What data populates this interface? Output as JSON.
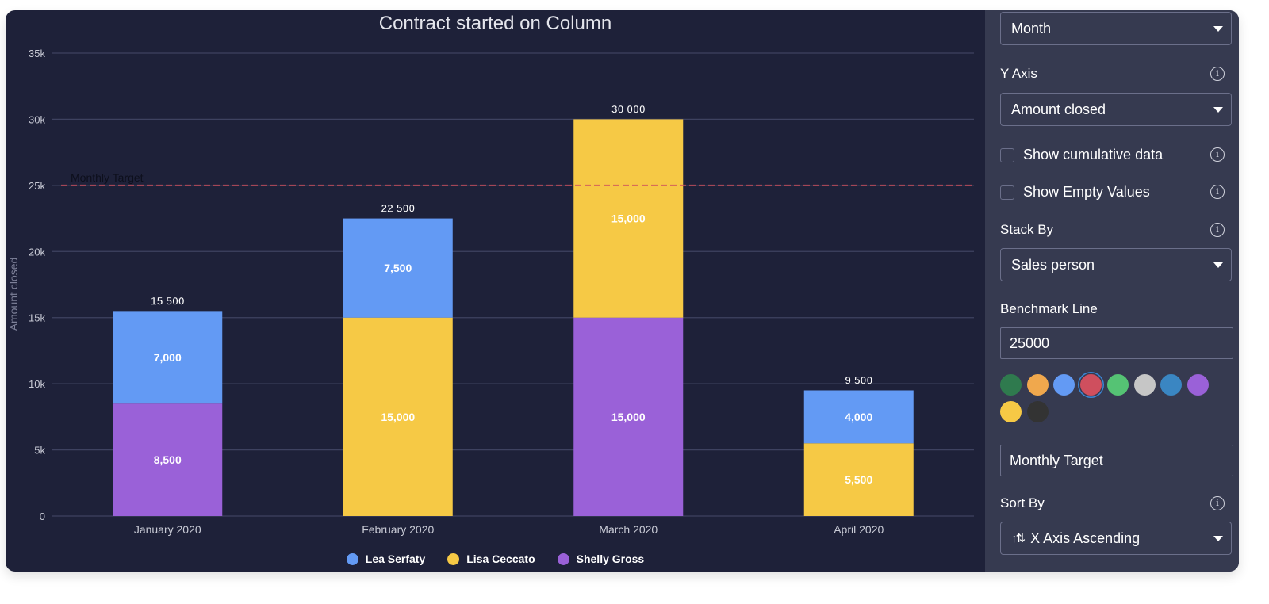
{
  "chart_data": {
    "type": "bar",
    "stacked": true,
    "title": "Contract started on Column",
    "xlabel": "",
    "ylabel": "Amount closed",
    "ylim": [
      0,
      35000
    ],
    "yticks": [
      0,
      5000,
      10000,
      15000,
      20000,
      25000,
      30000,
      35000
    ],
    "ytick_labels": [
      "0",
      "5k",
      "10k",
      "15k",
      "20k",
      "25k",
      "30k",
      "35k"
    ],
    "grid": true,
    "categories": [
      "January 2020",
      "February 2020",
      "March 2020",
      "April 2020"
    ],
    "series": [
      {
        "name": "Shelly Gross",
        "color": "#9a61d8",
        "values": [
          8500,
          0,
          15000,
          0
        ],
        "labels": [
          "8,500",
          "",
          "15,000",
          ""
        ]
      },
      {
        "name": "Lisa Ceccato",
        "color": "#f6c945",
        "values": [
          0,
          15000,
          15000,
          5500
        ],
        "labels": [
          "",
          "15,000",
          "15,000",
          "5,500"
        ]
      },
      {
        "name": "Lea Serfaty",
        "color": "#639af4",
        "values": [
          7000,
          7500,
          0,
          4000
        ],
        "labels": [
          "7,000",
          "7,500",
          "",
          "4,000"
        ]
      }
    ],
    "totals": [
      15500,
      22500,
      30000,
      9500
    ],
    "total_labels": [
      "15 500",
      "22 500",
      "30 000",
      "9 500"
    ],
    "benchmark": {
      "value": 25000,
      "label": "Monthly Target",
      "color": "#cf4f5e"
    },
    "legend": {
      "placement": "bottom-center",
      "entries": [
        {
          "name": "Lea Serfaty",
          "color": "#639af4"
        },
        {
          "name": "Lisa Ceccato",
          "color": "#f6c945"
        },
        {
          "name": "Shelly Gross",
          "color": "#9a61d8"
        }
      ]
    }
  },
  "panel": {
    "x_axis_group": {
      "value": "Month"
    },
    "y_axis": {
      "label": "Y Axis",
      "value": "Amount closed"
    },
    "show_cumulative": {
      "label": "Show cumulative data",
      "checked": false
    },
    "show_empty": {
      "label": "Show Empty Values",
      "checked": false
    },
    "stack_by": {
      "label": "Stack By",
      "value": "Sales person"
    },
    "benchmark": {
      "label": "Benchmark Line",
      "value": "25000",
      "name_value": "Monthly Target",
      "colors": [
        "#2f7a4e",
        "#f0a84d",
        "#639af4",
        "#cf4f5e",
        "#55c374",
        "#c6c6c6",
        "#3a86c2",
        "#9a61d8",
        "#f6c945",
        "#333333"
      ],
      "selected_color": "#cf4f5e"
    },
    "sort_by": {
      "label": "Sort By",
      "value": "X Axis Ascending",
      "icon": "sort-ascending-icon"
    },
    "info_glyph": "i"
  },
  "theme": {
    "chart_bg": "#1e2139",
    "panel_bg": "#363a50",
    "grid_color": "#3e4260"
  }
}
